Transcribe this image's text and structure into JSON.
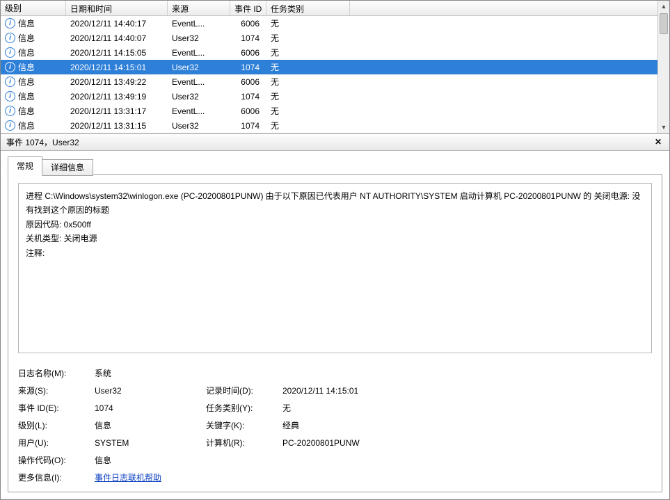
{
  "columns": {
    "level": "级别",
    "datetime": "日期和时间",
    "source": "来源",
    "eventId": "事件 ID",
    "taskCategory": "任务类别"
  },
  "rows": [
    {
      "level": "信息",
      "datetime": "2020/12/11 14:40:17",
      "source": "EventL...",
      "eventId": "6006",
      "cat": "无",
      "selected": false
    },
    {
      "level": "信息",
      "datetime": "2020/12/11 14:40:07",
      "source": "User32",
      "eventId": "1074",
      "cat": "无",
      "selected": false
    },
    {
      "level": "信息",
      "datetime": "2020/12/11 14:15:05",
      "source": "EventL...",
      "eventId": "6006",
      "cat": "无",
      "selected": false
    },
    {
      "level": "信息",
      "datetime": "2020/12/11 14:15:01",
      "source": "User32",
      "eventId": "1074",
      "cat": "无",
      "selected": true
    },
    {
      "level": "信息",
      "datetime": "2020/12/11 13:49:22",
      "source": "EventL...",
      "eventId": "6006",
      "cat": "无",
      "selected": false
    },
    {
      "level": "信息",
      "datetime": "2020/12/11 13:49:19",
      "source": "User32",
      "eventId": "1074",
      "cat": "无",
      "selected": false
    },
    {
      "level": "信息",
      "datetime": "2020/12/11 13:31:17",
      "source": "EventL...",
      "eventId": "6006",
      "cat": "无",
      "selected": false
    },
    {
      "level": "信息",
      "datetime": "2020/12/11 13:31:15",
      "source": "User32",
      "eventId": "1074",
      "cat": "无",
      "selected": false
    }
  ],
  "detail": {
    "title": "事件 1074，User32",
    "tabs": {
      "general": "常规",
      "details": "详细信息"
    },
    "description": {
      "line1": "进程 C:\\Windows\\system32\\winlogon.exe (PC-20200801PUNW) 由于以下原因已代表用户 NT AUTHORITY\\SYSTEM 启动计算机 PC-20200801PUNW 的 关闭电源: 没有找到这个原因的标题",
      "reasonCode": "原因代码: 0x500ff",
      "shutdownType": "关机类型: 关闭电源",
      "comment": "注释:"
    },
    "meta": {
      "logNameLabel": "日志名称(M):",
      "logName": "系统",
      "sourceLabel": "来源(S):",
      "source": "User32",
      "loggedLabel": "记录时间(D):",
      "logged": "2020/12/11 14:15:01",
      "eventIdLabel": "事件 ID(E):",
      "eventId": "1074",
      "taskCatLabel": "任务类别(Y):",
      "taskCat": "无",
      "levelLabel": "级别(L):",
      "level": "信息",
      "keywordsLabel": "关键字(K):",
      "keywords": "经典",
      "userLabel": "用户(U):",
      "user": "SYSTEM",
      "computerLabel": "计算机(R):",
      "computer": "PC-20200801PUNW",
      "opcodeLabel": "操作代码(O):",
      "opcode": "信息",
      "moreInfoLabel": "更多信息(I):",
      "moreInfoLink": "事件日志联机帮助"
    }
  }
}
